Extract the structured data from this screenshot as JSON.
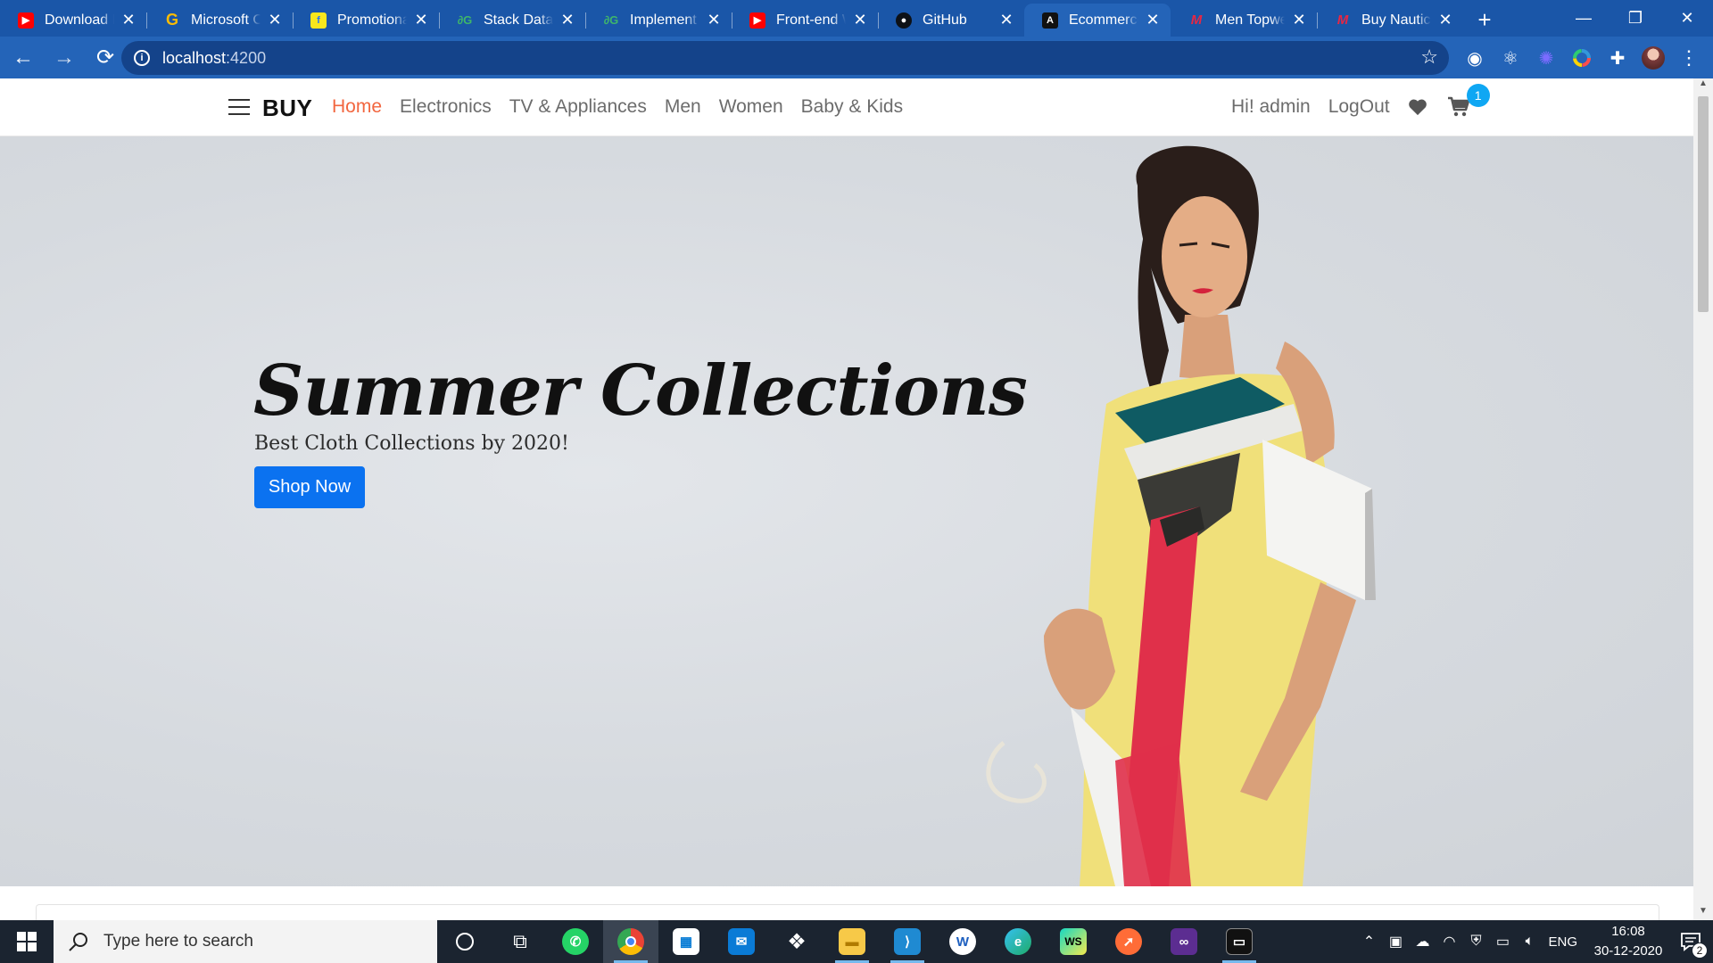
{
  "browser": {
    "tabs": [
      {
        "title": "Download In",
        "icon": "youtube-icon",
        "color": "#ff0000"
      },
      {
        "title": "Microsoft Of",
        "icon": "google-icon",
        "color": "#fbbc05"
      },
      {
        "title": "Promotional",
        "icon": "flipkart-icon",
        "color": "#f8e71c"
      },
      {
        "title": "Stack Data S",
        "icon": "geeksforgeeks-icon",
        "color": "#2f8d46"
      },
      {
        "title": "Implement t",
        "icon": "geeksforgeeks-icon",
        "color": "#2f8d46"
      },
      {
        "title": "Front-end W",
        "icon": "youtube-icon",
        "color": "#ff0000"
      },
      {
        "title": "GitHub",
        "icon": "github-icon",
        "color": "#111111"
      },
      {
        "title": "Ecommerce/",
        "icon": "angular-icon",
        "color": "#111111"
      },
      {
        "title": "Men Topwe",
        "icon": "myntra-icon",
        "color": "#e72744"
      },
      {
        "title": "Buy Nautica",
        "icon": "myntra-icon",
        "color": "#e72744"
      }
    ],
    "active_tab": 7,
    "url_host": "localhost",
    "url_port": ":4200"
  },
  "site": {
    "brand": "BUY",
    "nav": [
      {
        "label": "Home",
        "active": true
      },
      {
        "label": "Electronics"
      },
      {
        "label": "TV & Appliances"
      },
      {
        "label": "Men"
      },
      {
        "label": "Women"
      },
      {
        "label": "Baby & Kids"
      }
    ],
    "greeting": "Hi! admin",
    "logout": "LogOut",
    "cart_count": "1",
    "accent": "#f2663f"
  },
  "hero": {
    "title": "Summer Collections",
    "subtitle": "Best Cloth Collections by 2020!",
    "cta": "Shop Now",
    "cta_color": "#0b72f0"
  },
  "taskbar": {
    "search_placeholder": "Type here to search",
    "apps": [
      "cortana-icon",
      "task-view-icon",
      "whatsapp-icon",
      "chrome-icon",
      "store-icon",
      "mail-icon",
      "dropbox-icon",
      "file-explorer-icon",
      "vscode-icon",
      "writer-icon",
      "edge-icon",
      "webstorm-icon",
      "postman-icon",
      "visual-studio-icon",
      "terminal-icon"
    ],
    "lang": "ENG",
    "time": "16:08",
    "date": "30-12-2020",
    "notifications": "2"
  }
}
